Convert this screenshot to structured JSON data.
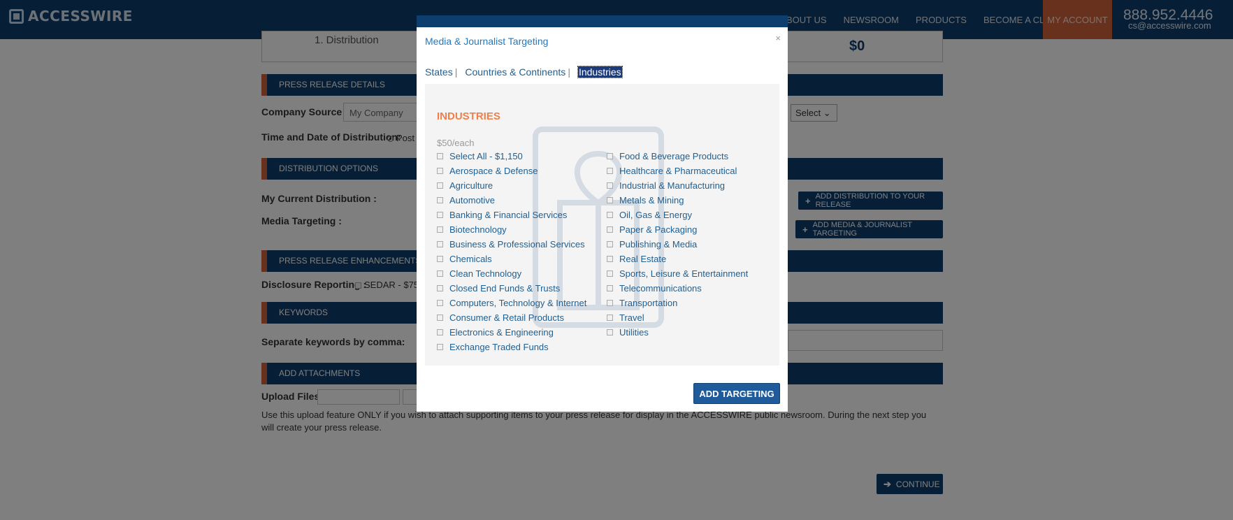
{
  "brand": {
    "logo_text": "ACCESSWIRE"
  },
  "nav": {
    "items": [
      "BOUT US",
      "NEWSROOM",
      "PRODUCTS",
      "BECOME A CLIENT"
    ],
    "my_account": "MY ACCOUNT",
    "phone": "888.952.4446",
    "email": "cs@accesswire.com"
  },
  "page": {
    "distribution_step": "1. Distribution",
    "price": "$0",
    "sections": {
      "press_release_details": "PRESS RELEASE DETAILS",
      "distribution_options": "DISTRIBUTION OPTIONS",
      "enhancements": "PRESS RELEASE ENHANCEMENTS AN",
      "keywords": "KEYWORDS",
      "attachments": "ADD ATTACHMENTS"
    },
    "company_source_label": "Company Source :",
    "company_source_value": "My Company",
    "select_value": "Select",
    "time_date_label": "Time and Date of Distribution:",
    "time_date_option": "Post",
    "my_current_distribution_label": "My Current Distribution :",
    "add_distribution_button": "ADD DISTRIBUTION TO YOUR RELEASE",
    "media_targeting_label": "Media Targeting :",
    "add_media_button": "ADD MEDIA & JOURNALIST TARGETING",
    "disclosure_label": "Disclosure Reporting :",
    "disclosure_option": "SEDAR - $75",
    "keywords_label": "Separate keywords by comma:",
    "upload_label": "Upload Files:",
    "upload_note_1": "Use this upload feature ONLY if you wish to attach supporting items to your press release for display in the ACCESSWIRE public newsroom. During the next step you",
    "upload_note_2": "will create your press release.",
    "continue_button": "CONTINUE"
  },
  "modal": {
    "title": "Media & Journalist Targeting",
    "close": "×",
    "tabs": [
      "States",
      "Countries & Continents",
      "Industries"
    ],
    "active_tab": "Industries",
    "heading": "INDUSTRIES",
    "price_note": "$50/each",
    "column1": [
      "Select All - $1,150",
      "Aerospace & Defense",
      "Agriculture",
      "Automotive",
      "Banking & Financial Services",
      "Biotechnology",
      "Business & Professional Services",
      "Chemicals",
      "Clean Technology",
      "Closed End Funds & Trusts",
      "Computers, Technology & Internet",
      "Consumer & Retail Products",
      "Electronics & Engineering",
      "Exchange Traded Funds"
    ],
    "column2": [
      "Food & Beverage Products",
      "Healthcare & Pharmaceutical",
      "Industrial & Manufacturing",
      "Metals & Mining",
      "Oil, Gas & Energy",
      "Paper & Packaging",
      "Publishing & Media",
      "Real Estate",
      "Sports, Leisure & Entertainment",
      "Telecommunications",
      "Transportation",
      "Travel",
      "Utilities"
    ],
    "add_button": "ADD TARGETING"
  }
}
